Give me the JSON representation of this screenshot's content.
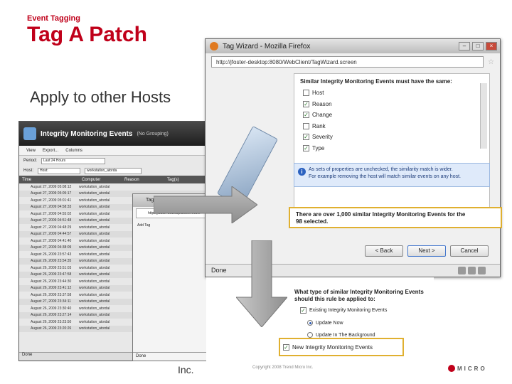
{
  "slide": {
    "kicker": "Event Tagging",
    "title": "Tag A Patch",
    "subtitle": "Apply to other Hosts",
    "inc": "Inc.",
    "copyright": "Copyright 2008 Trend Micro Inc.",
    "brand": "MICRO",
    "accent": "#c0001a"
  },
  "events_window": {
    "title": "Integrity Monitoring Events",
    "grouping": "(No Grouping)",
    "toolbar": [
      "View",
      "Export...",
      "Columns"
    ],
    "period_label": "Period:",
    "period_value": "Last 24 Hours",
    "host_label": "Host:",
    "host_value": "Host:",
    "host_input": "workstation_atorda",
    "columns": [
      "Time",
      "Computer",
      "Reason",
      "Tag(s)"
    ],
    "rows": [
      {
        "time": "August 27, 2009 05:08:12",
        "computer": "workstation_atordal"
      },
      {
        "time": "August 27, 2009 05:05:17",
        "computer": "workstation_atordal"
      },
      {
        "time": "August 27, 2009 05:01:41",
        "computer": "workstation_atordal"
      },
      {
        "time": "August 27, 2009 04:58:33",
        "computer": "workstation_atordal"
      },
      {
        "time": "August 27, 2009 04:55:02",
        "computer": "workstation_atordal"
      },
      {
        "time": "August 27, 2009 04:51:48",
        "computer": "workstation_atordal"
      },
      {
        "time": "August 27, 2009 04:48:29",
        "computer": "workstation_atordal"
      },
      {
        "time": "August 27, 2009 04:44:57",
        "computer": "workstation_atordal"
      },
      {
        "time": "August 27, 2009 04:41:40",
        "computer": "workstation_atordal"
      },
      {
        "time": "August 27, 2009 04:38:09",
        "computer": "workstation_atordal"
      },
      {
        "time": "August 26, 2009 23:57:43",
        "computer": "workstation_atordal"
      },
      {
        "time": "August 26, 2009 23:54:35",
        "computer": "workstation_atordal"
      },
      {
        "time": "August 26, 2009 23:51:03",
        "computer": "workstation_atordal"
      },
      {
        "time": "August 26, 2009 23:47:58",
        "computer": "workstation_atordal"
      },
      {
        "time": "August 26, 2009 23:44:30",
        "computer": "workstation_atordal"
      },
      {
        "time": "August 26, 2009 23:41:12",
        "computer": "workstation_atordal"
      },
      {
        "time": "August 26, 2009 23:37:58",
        "computer": "workstation_atordal"
      },
      {
        "time": "August 27, 2009 23:34:11",
        "computer": "workstation_atordal"
      },
      {
        "time": "August 26, 2009 23:30:40",
        "computer": "workstation_atordal"
      },
      {
        "time": "August 26, 2009 23:27:14",
        "computer": "workstation_atordal"
      },
      {
        "time": "August 26, 2009 23:23:50",
        "computer": "workstation_atordal"
      },
      {
        "time": "August 26, 2009 23:20:26",
        "computer": "workstation_atordal"
      }
    ],
    "footer": "Done"
  },
  "mid_window": {
    "title": "Tag W...",
    "url": "http://jfoster-desktop:8080/Web...",
    "add_label": "Add Tag",
    "footer": "Done"
  },
  "wizard": {
    "title": "Tag Wizard - Mozilla Firefox",
    "url": "http://jfoster-desktop:8080/WebClient/TagWizard.screen",
    "panel_heading": "Similar Integrity Monitoring Events must have the same:",
    "options": [
      {
        "label": "Host",
        "checked": false
      },
      {
        "label": "Reason",
        "checked": true
      },
      {
        "label": "Change",
        "checked": true
      },
      {
        "label": "Rank",
        "checked": false
      },
      {
        "label": "Severity",
        "checked": true
      },
      {
        "label": "Type",
        "checked": true
      }
    ],
    "info_line1": "As sets of properties are unchecked, the similarity match is wider.",
    "info_line2": "For example removing the host will match similar events on any host.",
    "highlight_line1": "There are over 1,000 similar Integrity Monitoring Events for the",
    "highlight_line2": "98 selected.",
    "btn_back": "< Back",
    "btn_next": "Next >",
    "btn_cancel": "Cancel",
    "status": "Done"
  },
  "lower_wizard": {
    "question": "What type of similar Integrity Monitoring Events should this rule be applied to:",
    "existing_label": "Existing Integrity Monitoring Events",
    "update_now": "Update Now",
    "update_bg": "Update In The Background",
    "new_events": "New Integrity Monitoring Events"
  }
}
